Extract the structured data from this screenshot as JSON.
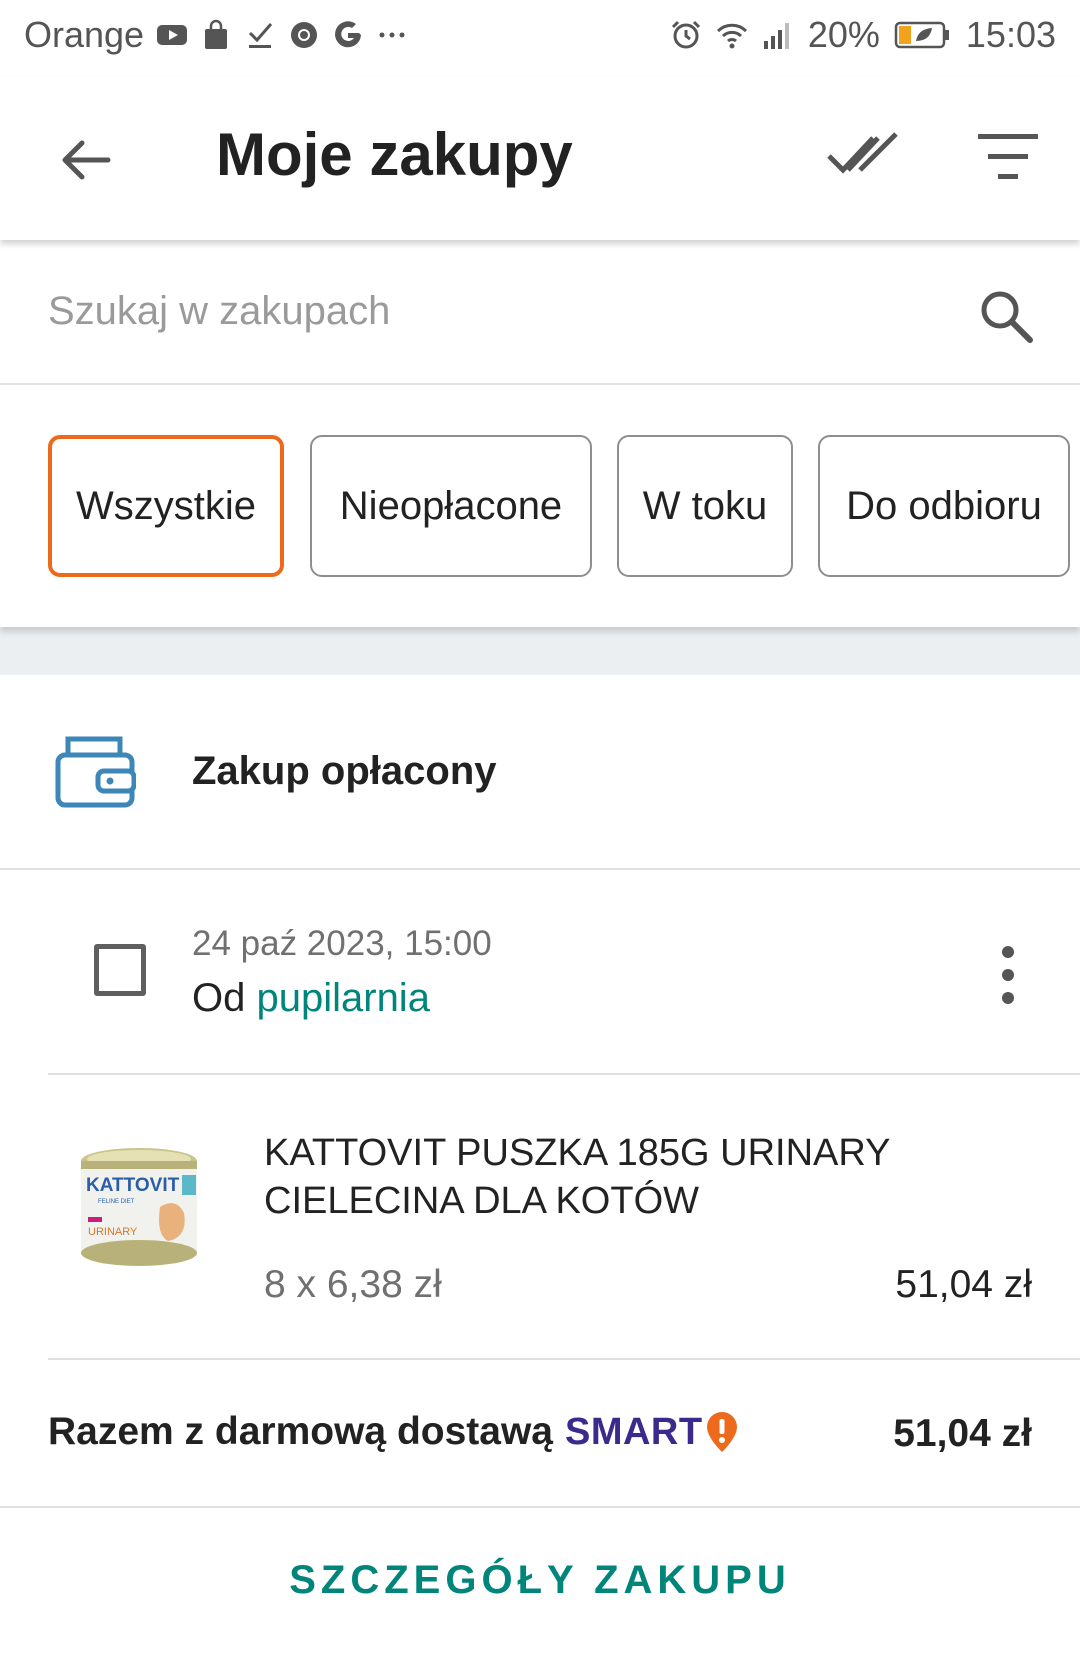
{
  "status_bar": {
    "carrier": "Orange",
    "battery": "20%",
    "time": "15:03",
    "icons_left": [
      "youtube-icon",
      "shopping-bag-icon",
      "check-icon",
      "chrome-icon",
      "google-icon",
      "more-icon"
    ],
    "icons_right": [
      "alarm-icon",
      "wifi-icon",
      "signal-icon",
      "battery-icon"
    ]
  },
  "appbar": {
    "title": "Moje zakupy",
    "icons": [
      "back-arrow-icon",
      "double-check-icon",
      "filter-icon"
    ]
  },
  "search": {
    "placeholder": "Szukaj w zakupach",
    "value": "",
    "icon": "search-icon"
  },
  "filters": [
    {
      "label": "Wszystkie",
      "active": true
    },
    {
      "label": "Nieopłacone",
      "active": false
    },
    {
      "label": "W toku",
      "active": false
    },
    {
      "label": "Do odbioru",
      "active": false
    }
  ],
  "order": {
    "status": "Zakup opłacony",
    "date": "24 paź 2023, 15:00",
    "from_prefix": "Od",
    "seller": "pupilarnia",
    "item": {
      "name": "KATTOVIT PUSZKA 185G URINARY CIELECINA DLA KOTÓW",
      "quantity_price": "8 x 6,38 zł",
      "total": "51,04 zł",
      "image_brand": "KATTOVIT",
      "image_subtitle": "FELINE DIET",
      "image_variant": "URINARY"
    },
    "summary_label": "Razem z darmową dostawą",
    "smart_label": "SMART",
    "summary_value": "51,04 zł",
    "details_button": "SZCZEGÓŁY ZAKUPU"
  },
  "colors": {
    "accent_orange": "#ed6a1c",
    "link_teal": "#00857a",
    "smart_purple": "#3b2a8c",
    "wallet_blue": "#3d86b8"
  }
}
